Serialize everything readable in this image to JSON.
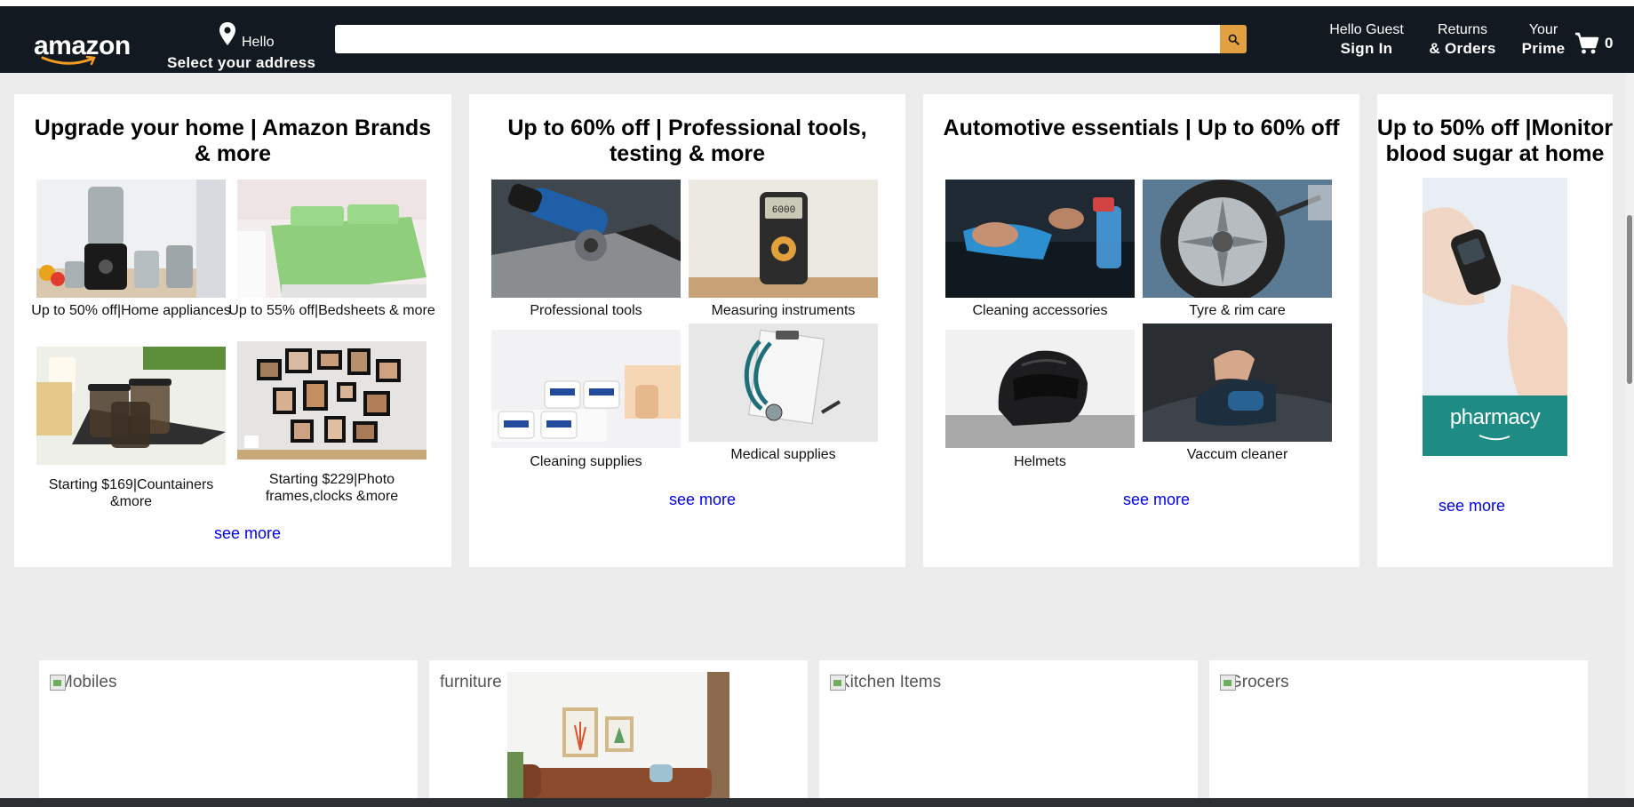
{
  "header": {
    "logo_text": "amazon",
    "greeting": "Hello",
    "address_label": "Select your address",
    "search": {
      "placeholder": "",
      "value": ""
    },
    "account": {
      "line1": "Hello Guest",
      "line2": "Sign In"
    },
    "returns": {
      "line1": "Returns",
      "line2": "& Orders"
    },
    "prime": {
      "line1": "Your",
      "line2": "Prime"
    },
    "cart_count": "0"
  },
  "cards": [
    {
      "title": "Upgrade your home | Amazon Brands & more",
      "tiles": [
        {
          "label": "Up to 50% off|Home appliances",
          "image": "mixer-grinder"
        },
        {
          "label": "Up to 55% off|Bedsheets & more",
          "image": "green-bed"
        },
        {
          "label": "Starting $169|Countainers &more",
          "image": "storage-containers"
        },
        {
          "label": "Starting $229|Photo frames,clocks &more",
          "image": "photo-frames"
        }
      ],
      "see_more": "see more"
    },
    {
      "title": "Up to 60% off | Professional tools, testing & more",
      "tiles": [
        {
          "label": "Professional tools",
          "image": "angle-grinder"
        },
        {
          "label": "Measuring instruments",
          "image": "multimeter"
        },
        {
          "label": "Cleaning supplies",
          "image": "cleaning-rolls"
        },
        {
          "label": "Medical supplies",
          "image": "stethoscope"
        }
      ],
      "see_more": "see more"
    },
    {
      "title": "Automotive essentials | Up to 60% off",
      "tiles": [
        {
          "label": "Cleaning accessories",
          "image": "car-cleaning"
        },
        {
          "label": "Tyre & rim care",
          "image": "tyre-rim"
        },
        {
          "label": "Helmets",
          "image": "helmet"
        },
        {
          "label": "Vaccum cleaner",
          "image": "car-vacuum"
        }
      ],
      "see_more": "see more"
    },
    {
      "title": "Up to 50% off |Monitor blood sugar at home",
      "image_text": "pharmacy",
      "see_more": "see more"
    }
  ],
  "bottom_boxes": [
    {
      "label": "Mobiles"
    },
    {
      "label": "furniture"
    },
    {
      "label": "Kitchen Items"
    },
    {
      "label": "Grocers"
    }
  ],
  "colors": {
    "nav_bg": "#131921",
    "search_button": "#e3a040",
    "page_bg": "#ececec",
    "link": "#0000ee"
  }
}
